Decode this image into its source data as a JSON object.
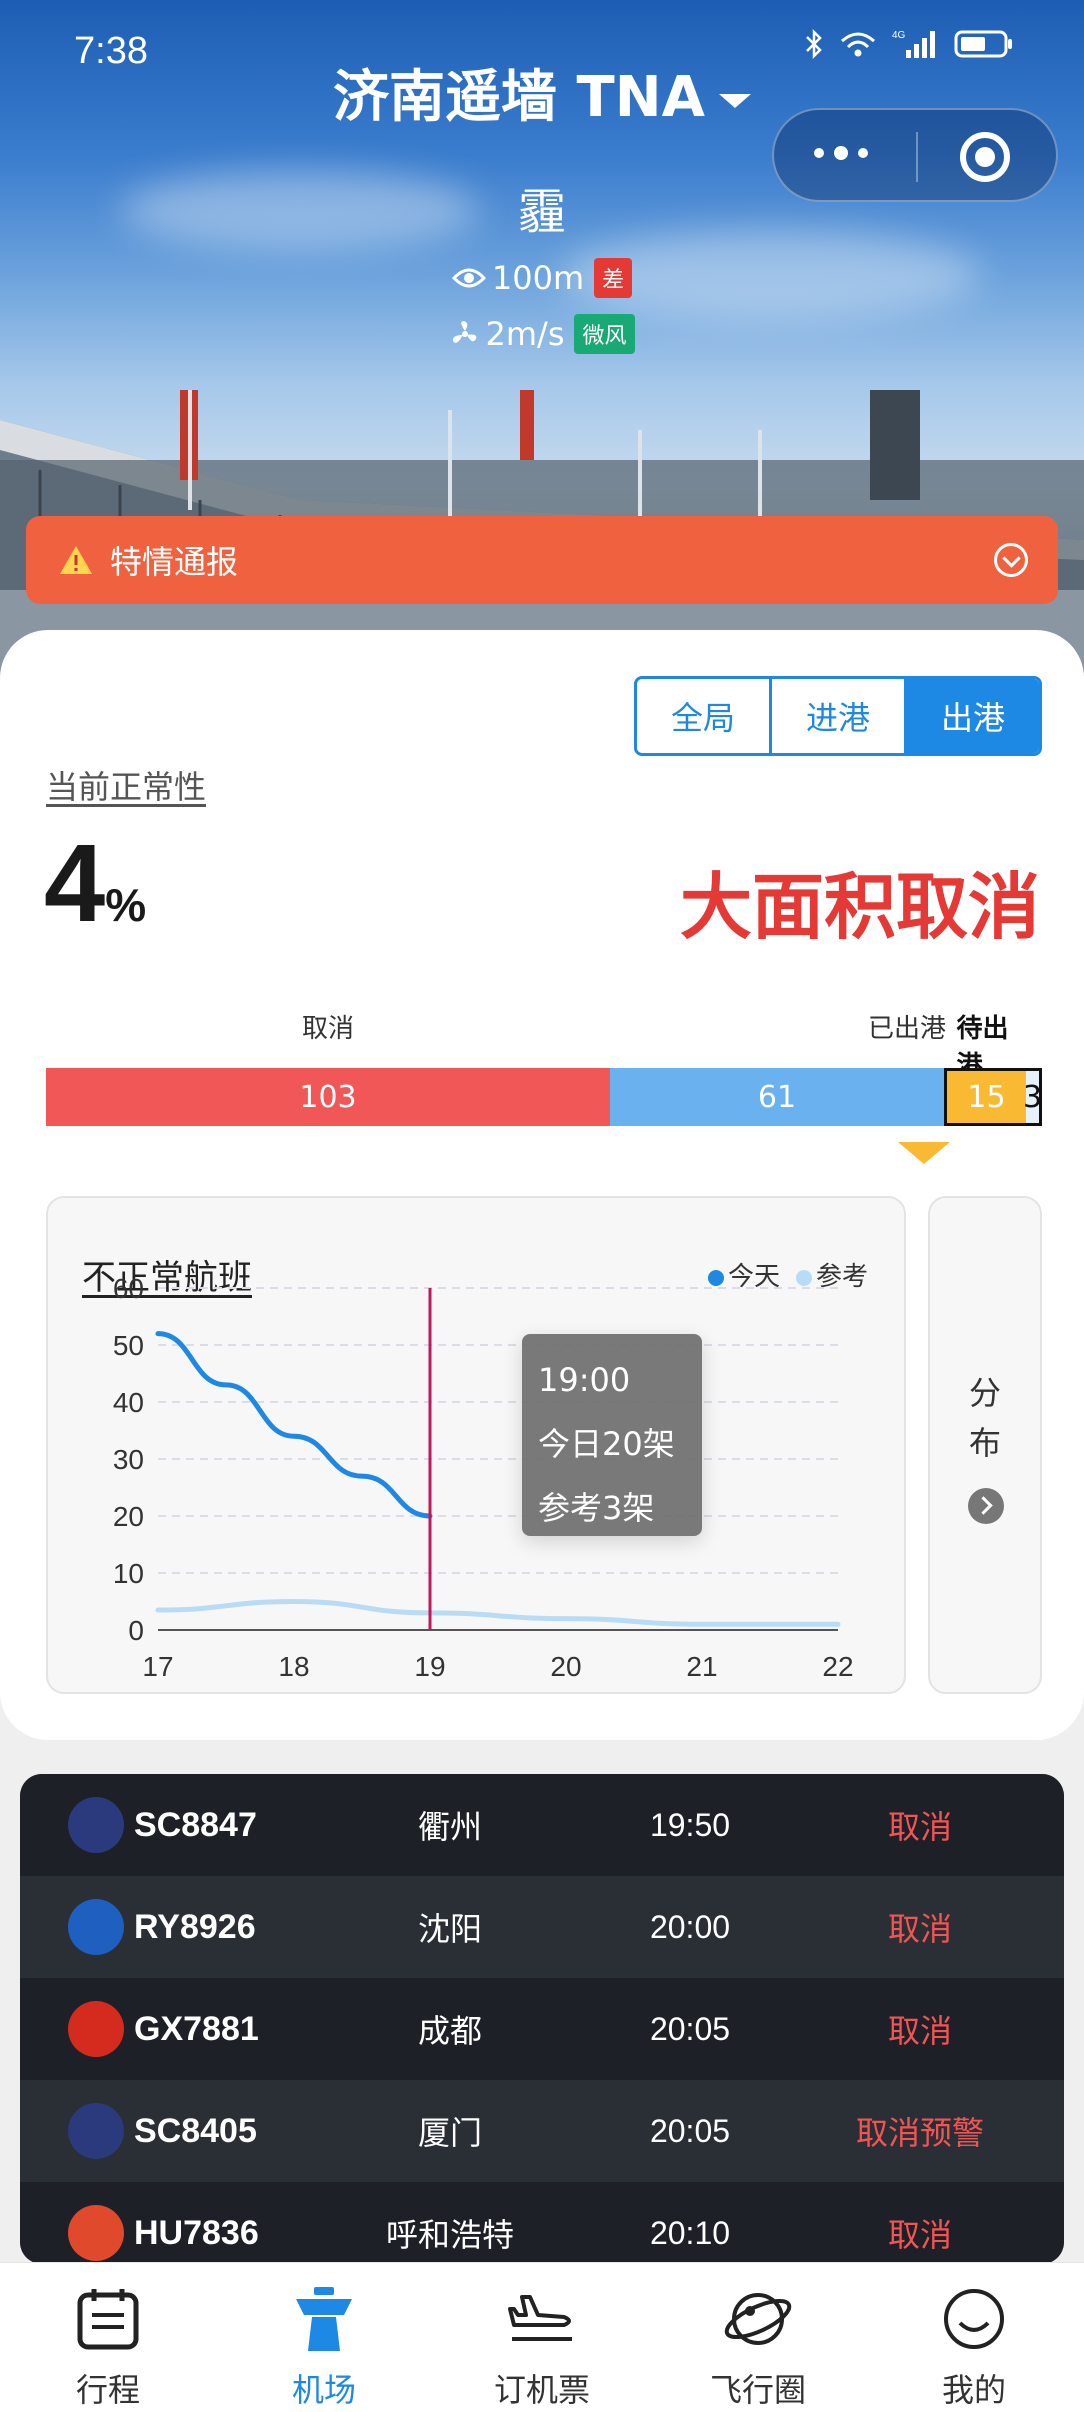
{
  "status_bar": {
    "time": "7:38",
    "network": "4G"
  },
  "header": {
    "airport": "济南遥墙 TNA"
  },
  "weather": {
    "condition": "霾",
    "visibility": "100m",
    "visibility_tag": "差",
    "wind": "2m/s",
    "wind_tag": "微风"
  },
  "alert": {
    "text": "特情通报"
  },
  "segment": {
    "all": "全局",
    "arrive": "进港",
    "depart": "出港",
    "selected": "出港"
  },
  "normality": {
    "label": "当前正常性",
    "value": "4",
    "unit": "%",
    "status": "大面积取消"
  },
  "progress": {
    "labels": {
      "cancel": "取消",
      "departed": "已出港",
      "waiting": "待出港"
    },
    "values": {
      "cancel": 103,
      "departed": 61,
      "waiting": 15,
      "other": 3
    },
    "values_text": {
      "cancel": "103",
      "departed": "61",
      "waiting": "15",
      "other": "3"
    }
  },
  "chart": {
    "title": "不正常航班",
    "legend_today": "今天",
    "legend_ref": "参考",
    "tooltip": {
      "time": "19:00",
      "today": "今日20架",
      "ref": "参考3架"
    },
    "colors": {
      "today": "#1e88e5",
      "ref": "#b9dcf6",
      "marker": "#c2185b"
    }
  },
  "chart_data": {
    "type": "line",
    "x_ticks": [
      "17",
      "18",
      "19",
      "20",
      "21",
      "22"
    ],
    "y_ticks": [
      "0",
      "10",
      "20",
      "30",
      "40",
      "50",
      "60"
    ],
    "xlim": [
      17,
      22
    ],
    "ylim": [
      0,
      60
    ],
    "grid": true,
    "legend": "top-right",
    "marker_x": 19,
    "series": [
      {
        "name": "今天",
        "x": [
          17,
          17.5,
          18,
          18.5,
          19
        ],
        "values": [
          52,
          43,
          34,
          27,
          20
        ]
      },
      {
        "name": "参考",
        "x": [
          17,
          18,
          19,
          20,
          21,
          22
        ],
        "values": [
          3.5,
          5,
          3,
          2,
          1,
          1
        ]
      }
    ]
  },
  "side_panel": {
    "label_1": "分",
    "label_2": "布"
  },
  "flights": [
    {
      "no": "SC8847",
      "city": "衢州",
      "time": "19:50",
      "status": "取消",
      "logo_color": "#2b3a7c"
    },
    {
      "no": "RY8926",
      "city": "沈阳",
      "time": "20:00",
      "status": "取消",
      "logo_color": "#1f5fbf"
    },
    {
      "no": "GX7881",
      "city": "成都",
      "time": "20:05",
      "status": "取消",
      "logo_color": "#d52b1e"
    },
    {
      "no": "SC8405",
      "city": "厦门",
      "time": "20:05",
      "status": "取消预警",
      "logo_color": "#2b3a7c"
    },
    {
      "no": "HU7836",
      "city": "呼和浩特",
      "time": "20:10",
      "status": "取消",
      "logo_color": "#e0492c"
    }
  ],
  "tabs": [
    {
      "label": "行程",
      "icon": "calendar-icon"
    },
    {
      "label": "机场",
      "icon": "control-tower-icon"
    },
    {
      "label": "订机票",
      "icon": "plane-icon"
    },
    {
      "label": "飞行圈",
      "icon": "planet-icon"
    },
    {
      "label": "我的",
      "icon": "smile-icon"
    }
  ]
}
